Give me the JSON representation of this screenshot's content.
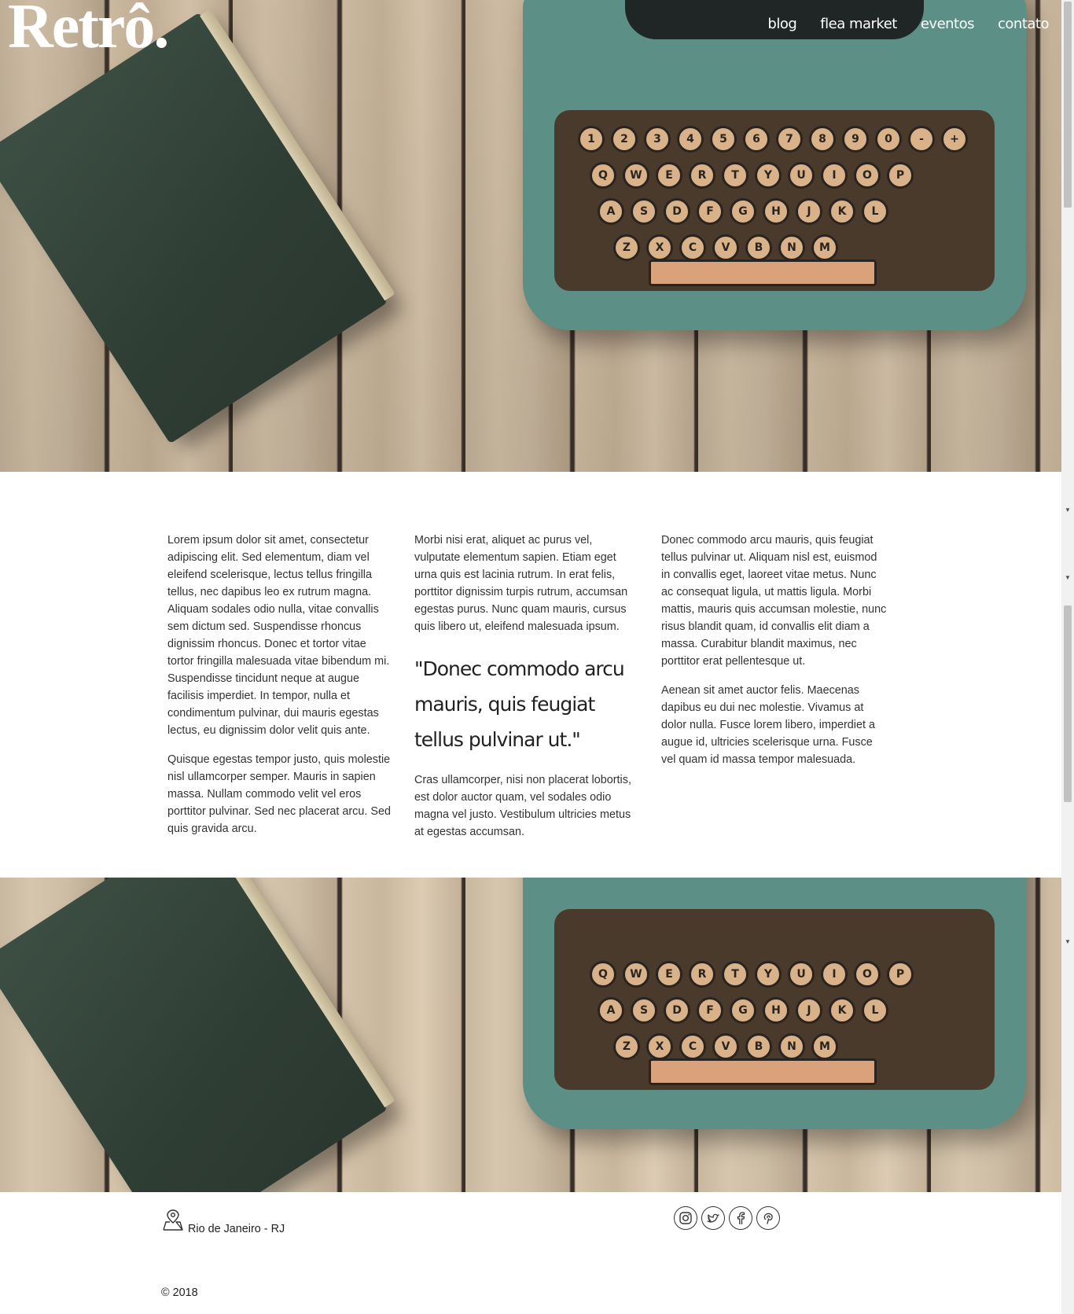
{
  "header": {
    "logo": "Retrô.",
    "nav": [
      "blog",
      "flea market",
      "eventos",
      "contato"
    ]
  },
  "content": {
    "col1": {
      "p1": "Lorem ipsum dolor sit amet, consectetur adipiscing elit. Sed elementum, diam vel eleifend scelerisque, lectus tellus fringilla tellus, nec dapibus leo ex rutrum magna. Aliquam sodales odio nulla, vitae convallis sem dictum sed. Suspendisse rhoncus dignissim rhoncus. Donec et tortor vitae tortor fringilla malesuada vitae bibendum mi. Suspendisse tincidunt neque at augue facilisis imperdiet. In tempor, nulla et condimentum pulvinar, dui mauris egestas lectus, eu dignissim dolor velit quis ante.",
      "p2": "Quisque egestas tempor justo, quis molestie nisl ullamcorper semper. Mauris in sapien massa. Nullam commodo velit vel eros porttitor pulvinar. Sed nec placerat arcu. Sed quis gravida arcu."
    },
    "col2": {
      "p1": "Morbi nisi erat, aliquet ac purus vel, vulputate elementum sapien. Etiam eget urna quis est lacinia rutrum. In erat felis, porttitor dignissim turpis rutrum, accumsan egestas purus. Nunc quam mauris, cursus quis libero ut, eleifend malesuada ipsum.",
      "quote": "\"Donec commodo arcu mauris, quis feugiat tellus pulvinar ut.\"",
      "p2": "Cras ullamcorper, nisi non placerat lobortis, est dolor auctor quam, vel sodales odio magna vel justo. Vestibulum ultricies metus at egestas accumsan."
    },
    "col3": {
      "p1": "Donec commodo arcu mauris, quis feugiat tellus pulvinar ut. Aliquam nisl est, euismod in convallis eget, laoreet vitae metus. Nunc ac consequat ligula, ut mattis ligula. Morbi mattis, mauris quis accumsan molestie, nunc risus blandit quam, id convallis elit diam a massa. Curabitur blandit maximus, nec porttitor erat pellentesque ut.",
      "p2": "Aenean sit amet auctor felis. Maecenas dapibus eu dui nec molestie. Vivamus at dolor nulla. Fusce lorem libero, imperdiet a augue id, ultricies scelerisque urna. Fusce vel quam id massa tempor malesuada."
    }
  },
  "typewriter_keys": {
    "row1": [
      "1",
      "2",
      "3",
      "4",
      "5",
      "6",
      "7",
      "8",
      "9",
      "0",
      "-",
      "+"
    ],
    "row2": [
      "Q",
      "W",
      "E",
      "R",
      "T",
      "Y",
      "U",
      "I",
      "O",
      "P"
    ],
    "row3": [
      "A",
      "S",
      "D",
      "F",
      "G",
      "H",
      "J",
      "K",
      "L"
    ],
    "row4": [
      "Z",
      "X",
      "C",
      "V",
      "B",
      "N",
      "M"
    ]
  },
  "footer": {
    "location": "Rio de Janeiro - RJ",
    "social": [
      "instagram-icon",
      "twitter-icon",
      "facebook-icon",
      "pinterest-icon"
    ],
    "copyright": "© 2018"
  }
}
